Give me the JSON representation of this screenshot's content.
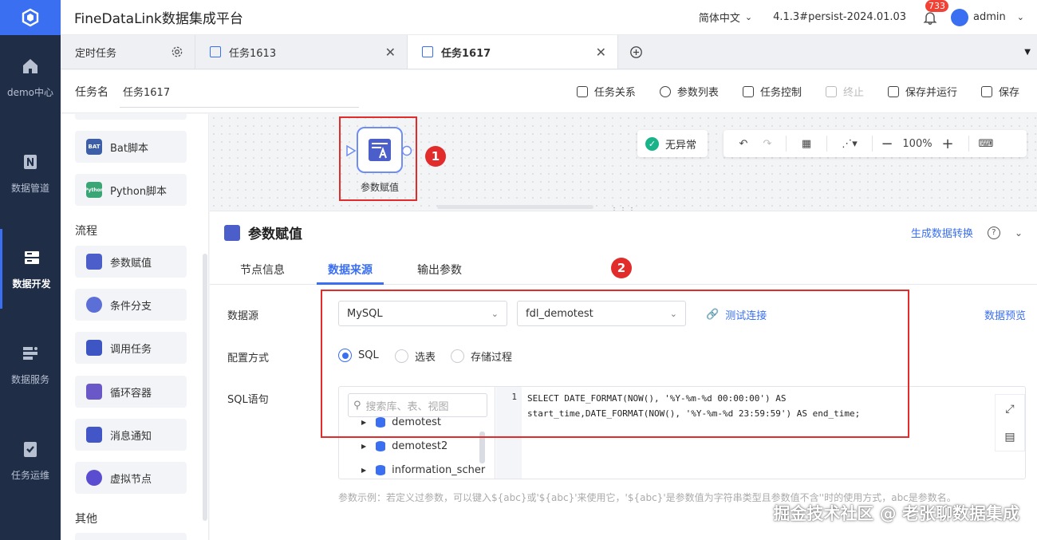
{
  "app": {
    "title": "FineDataLink数据集成平台",
    "language": "简体中文",
    "version": "4.1.3#persist-2024.01.03",
    "notification_count": "733",
    "user": "admin"
  },
  "nav": [
    {
      "label": "demo中心",
      "icon": "home-icon"
    },
    {
      "label": "数据管道",
      "icon": "pipeline-icon"
    },
    {
      "label": "数据开发",
      "icon": "dev-icon"
    },
    {
      "label": "数据服务",
      "icon": "service-icon"
    },
    {
      "label": "任务运维",
      "icon": "ops-icon"
    }
  ],
  "tabs": [
    {
      "label": "定时任务"
    },
    {
      "label": "任务1613"
    },
    {
      "label": "任务1617"
    }
  ],
  "task": {
    "name_label": "任务名",
    "name_value": "任务1617",
    "actions": [
      "任务关系",
      "参数列表",
      "任务控制",
      "终止",
      "保存并运行",
      "保存"
    ]
  },
  "palette": {
    "items_top": [
      "Bat脚本",
      "Python脚本"
    ],
    "section_flow": "流程",
    "flow_items": [
      "参数赋值",
      "条件分支",
      "调用任务",
      "循环容器",
      "消息通知",
      "虚拟节点"
    ],
    "section_other": "其他",
    "bat_tag": "BAT",
    "python_tag": "Python"
  },
  "canvas": {
    "node_label": "参数赋值",
    "status": "无异常",
    "zoom": "100%",
    "marker1": "1"
  },
  "panel": {
    "title": "参数赋值",
    "generate_link": "生成数据转换",
    "subtabs": [
      "节点信息",
      "数据来源",
      "输出参数"
    ],
    "marker2": "2",
    "datasource_label": "数据源",
    "datasource_type": "MySQL",
    "datasource_conn": "fdl_demotest",
    "test_conn": "测试连接",
    "preview": "数据预览",
    "config_label": "配置方式",
    "config_options": [
      "SQL",
      "选表",
      "存储过程"
    ],
    "sql_label": "SQL语句",
    "tree_search_placeholder": "搜索库、表、视图",
    "tree_items": [
      "demotest",
      "demotest2",
      "information_scher"
    ],
    "line_no": "1",
    "code_line1": "SELECT DATE_FORMAT(NOW(), '%Y-%m-%d 00:00:00') AS",
    "code_line2": "start_time,DATE_FORMAT(NOW(), '%Y-%m-%d 23:59:59') AS end_time;",
    "hint": "参数示例：若定义过参数，可以键入${abc}或'${abc}'来使用它，'${abc}'是参数值为字符串类型且参数值不含''时的使用方式，abc是参数名。"
  },
  "watermark": "掘金技术社区 @ 老张聊数据集成"
}
